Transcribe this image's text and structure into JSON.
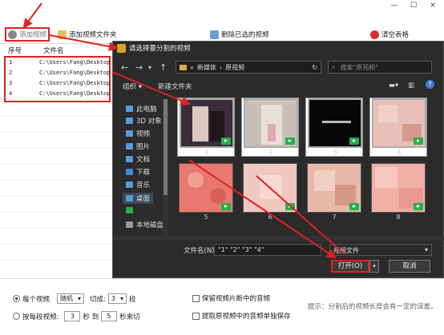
{
  "window": {
    "minimize": "—",
    "maximize": "☐",
    "close": "×"
  },
  "toolbar": {
    "add_video": "添加视频",
    "add_folder": "添加视频文件夹",
    "delete_cut": "删除已选的视频",
    "clear_table": "清空表格"
  },
  "table": {
    "col_index": "序号",
    "col_filename": "文件名",
    "rows": [
      {
        "index": "1",
        "name": "C:\\Users\\Fang\\Desktop"
      },
      {
        "index": "2",
        "name": "C:\\Users\\Fang\\Desktop"
      },
      {
        "index": "3",
        "name": "C:\\Users\\Fang\\Desktop"
      },
      {
        "index": "4",
        "name": "C:\\Users\\Fang\\Desktop"
      }
    ]
  },
  "options": {
    "per_video_label": "每个视频",
    "mode_value": "随机",
    "cut_label": "切成:",
    "segments_value": "3",
    "segments_unit": "段",
    "by_duration_label": "按每段视频:",
    "sec_from": "3",
    "sec_unit": "秒 到",
    "sec_to": "5",
    "sec_to_unit": "秒来切",
    "keep_audio": "保留视频片断中的音频",
    "extract_audio": "提取原视频中的音频单独保存",
    "hint": "提示：分割后的视频长度会有一定的误差。"
  },
  "dialog": {
    "title": "请选择要分割的视频",
    "path": [
      "新媒体",
      "原视频"
    ],
    "search_placeholder": "搜索\"原视频\"",
    "organize": "组织 ▾",
    "new_folder": "新建文件夹",
    "sidebar": [
      "此电脑",
      "3D 对象",
      "视频",
      "图片",
      "文档",
      "下载",
      "音乐",
      "桌面",
      "",
      "本地磁盘"
    ],
    "thumbs": [
      "1",
      "2",
      "3",
      "4",
      "5",
      "6",
      "7",
      "8"
    ],
    "filename_label": "文件名(N):",
    "filename_value": "\"1\" \"2\" \"3\" \"4\"",
    "filetype_value": "视频文件",
    "open_label": "打开(O)",
    "cancel_label": "取消"
  },
  "colors": {
    "highlight": "#e02020",
    "play_badge": "#22b14c"
  }
}
